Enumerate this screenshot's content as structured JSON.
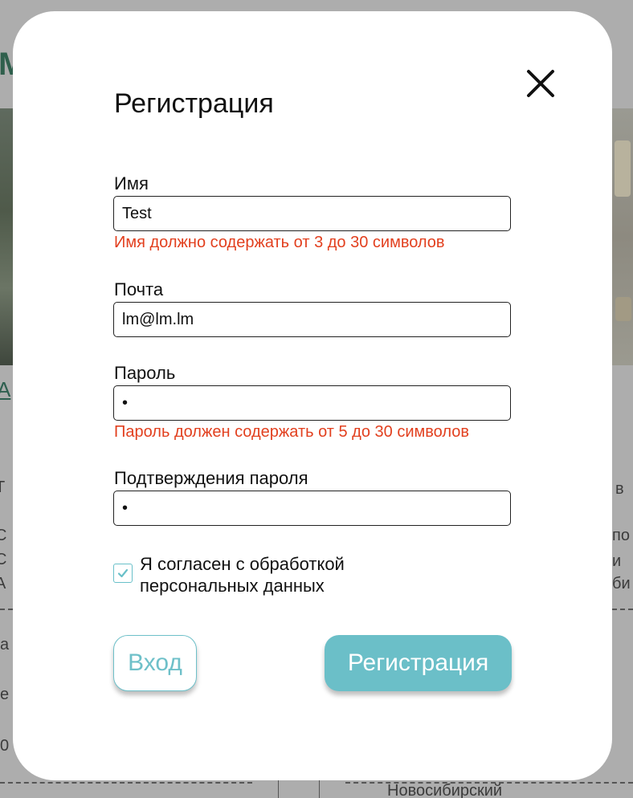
{
  "background": {
    "logo_fragment": "M",
    "link_fragment": "А",
    "left_fragments": [
      "Т",
      ", ",
      "С",
      " С",
      "А",
      "а",
      "е",
      "0"
    ],
    "right_fragments": [
      "в",
      "по",
      "и",
      "би"
    ],
    "bottom_text": "Новосибирский"
  },
  "modal": {
    "title": "Регистрация",
    "fields": [
      {
        "label": "Имя",
        "value": "Test",
        "error": "Имя должно содержать от 3 до 30 символов"
      },
      {
        "label": "Почта",
        "value": "lm@lm.lm",
        "error": ""
      },
      {
        "label": "Пароль",
        "value": "•",
        "error": "Пароль должен содержать от 5 до 30 символов"
      },
      {
        "label": "Подтверждения пароля",
        "value": "•",
        "error": ""
      }
    ],
    "consent": {
      "label": "Я согласен с обработкой персональных данных",
      "checked": true
    },
    "login_button": "Вход",
    "register_button": "Регистрация"
  },
  "colors": {
    "accent": "#6bbfc8",
    "error": "#e2401f",
    "overlay": "#adadad"
  },
  "icons": {
    "close": "close-icon",
    "check": "check-icon"
  }
}
